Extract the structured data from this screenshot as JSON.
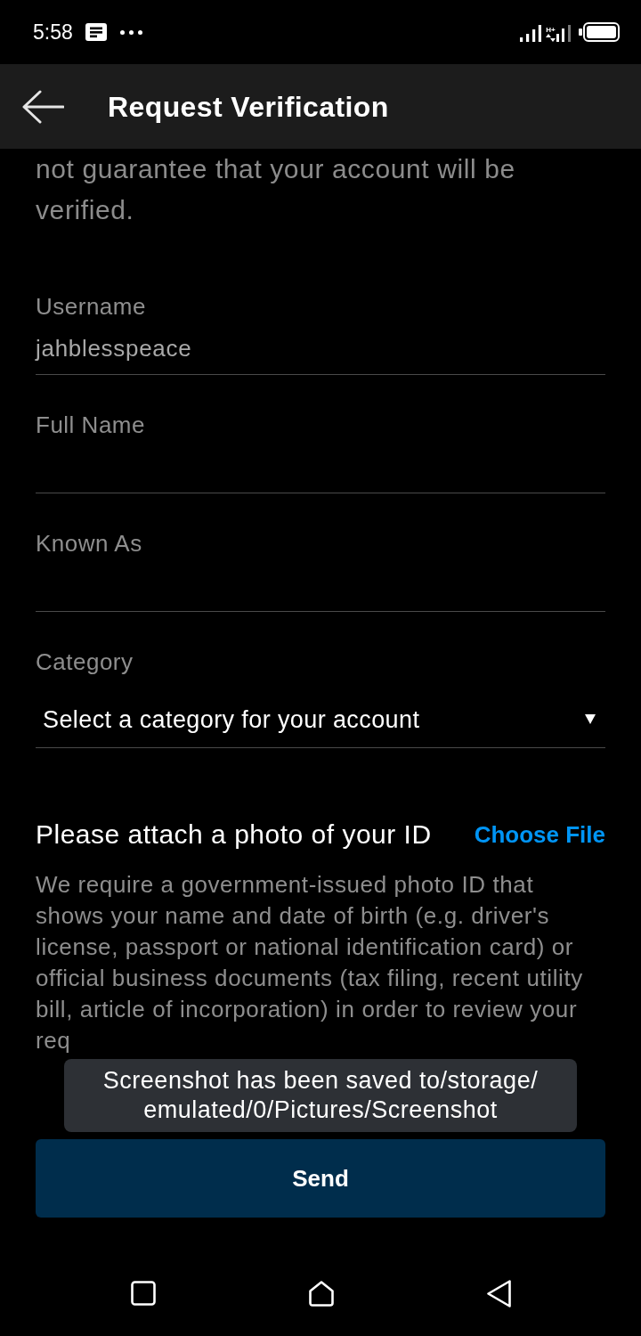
{
  "status_bar": {
    "time": "5:58",
    "network_type": "H+"
  },
  "app_bar": {
    "title": "Request Verification"
  },
  "intro": "not guarantee that your account will be verified.",
  "fields": [
    {
      "kind": "text",
      "label": "Username",
      "value": "jahblesspeace"
    },
    {
      "kind": "text",
      "label": "Full Name"
    },
    {
      "kind": "text",
      "label": "Known As"
    },
    {
      "kind": "select",
      "label": "Category",
      "value": "Select a category for your account"
    }
  ],
  "attachment": {
    "heading": "Please attach a photo of your ID",
    "action": "Choose File",
    "description": "We require a government-issued photo ID that shows your name and date of birth (e.g. driver's license, passport or national identification card) or official business documents (tax filing, recent utility bill, article of incorporation) in order to review your req"
  },
  "toast": "Screenshot has been saved to/storage/ emulated/0/Pictures/Screenshot",
  "send_button": "Send"
}
